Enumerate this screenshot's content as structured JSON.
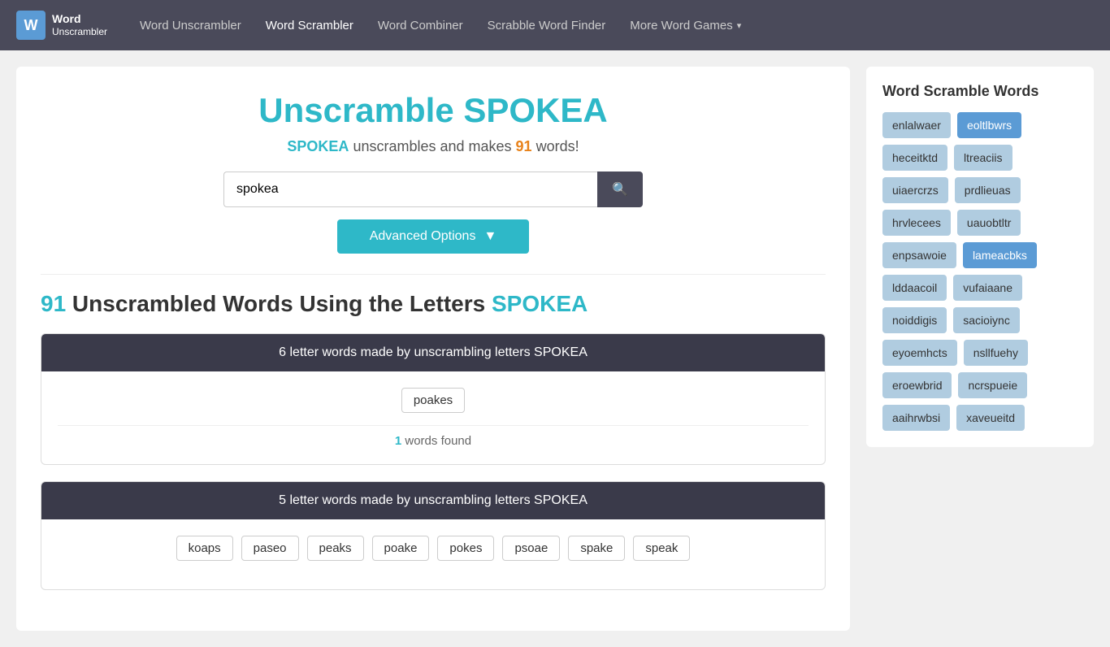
{
  "navbar": {
    "brand_letter": "W",
    "brand_line1": "Word",
    "brand_line2": "Unscrambler",
    "links": [
      {
        "id": "word-unscrambler",
        "label": "Word Unscrambler",
        "active": true
      },
      {
        "id": "word-scrambler",
        "label": "Word Scrambler",
        "active": false
      },
      {
        "id": "word-combiner",
        "label": "Word Combiner",
        "active": false
      },
      {
        "id": "scrabble-word-finder",
        "label": "Scrabble Word Finder",
        "active": false
      }
    ],
    "more_label": "More Word Games",
    "dropdown_arrow": "▾"
  },
  "main": {
    "page_title": "Unscramble SPOKEA",
    "subtitle_word": "SPOKEA",
    "subtitle_text": " unscrambles and makes ",
    "subtitle_count": "91",
    "subtitle_end": " words!",
    "search_value": "spokea",
    "search_placeholder": "spokea",
    "search_btn_icon": "🔍",
    "advanced_btn_label": "Advanced Options",
    "advanced_btn_arrow": "▼",
    "results_count": "91",
    "results_text": " Unscrambled Words Using the Letters ",
    "results_letters": "SPOKEA",
    "word_groups": [
      {
        "id": "6letter",
        "header": "6 letter words made by unscrambling letters SPOKEA",
        "words": [
          "poakes"
        ],
        "count": "1",
        "count_text": " words found"
      },
      {
        "id": "5letter",
        "header": "5 letter words made by unscrambling letters SPOKEA",
        "words": [
          "koaps",
          "paseo",
          "peaks",
          "poake",
          "pokes",
          "psoae",
          "spake",
          "speak"
        ],
        "count": null,
        "count_text": null
      }
    ]
  },
  "sidebar": {
    "title": "Word Scramble Words",
    "words": [
      {
        "label": "enlalwaer",
        "wide": false
      },
      {
        "label": "eoltlbwrs",
        "wide": true
      },
      {
        "label": "heceitktd",
        "wide": false
      },
      {
        "label": "ltreaciis",
        "wide": false
      },
      {
        "label": "uiaercrzs",
        "wide": false
      },
      {
        "label": "prdlieuas",
        "wide": false
      },
      {
        "label": "hrvlecees",
        "wide": false
      },
      {
        "label": "uauobtltr",
        "wide": false
      },
      {
        "label": "enpsawoie",
        "wide": false
      },
      {
        "label": "lameacbks",
        "wide": true
      },
      {
        "label": "lddaacoil",
        "wide": false
      },
      {
        "label": "vufaiaane",
        "wide": false
      },
      {
        "label": "noiddigis",
        "wide": false
      },
      {
        "label": "sacioiync",
        "wide": false
      },
      {
        "label": "eyoemhcts",
        "wide": false
      },
      {
        "label": "nsllfuehy",
        "wide": false
      },
      {
        "label": "eroewbrid",
        "wide": false
      },
      {
        "label": "ncrspueie",
        "wide": false
      },
      {
        "label": "aaihrwbsi",
        "wide": false
      },
      {
        "label": "xaveueitd",
        "wide": false
      }
    ]
  }
}
